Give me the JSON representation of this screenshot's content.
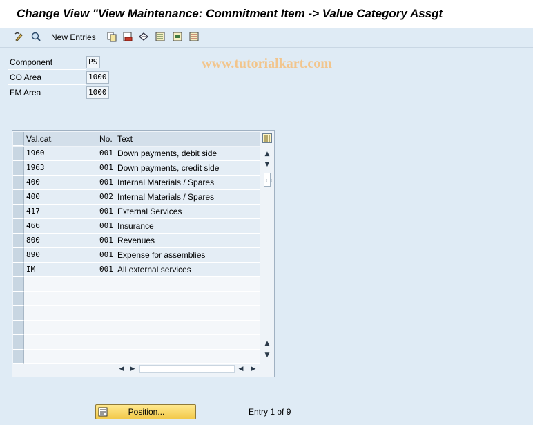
{
  "window": {
    "title": "Change View \"View Maintenance: Commitment Item -> Value Category Assgt"
  },
  "toolbar": {
    "new_entries_label": "New Entries",
    "icons": [
      "display-change-icon",
      "other-view-icon",
      "copy-icon",
      "delete-icon",
      "undo-icon",
      "select-all-icon",
      "select-block-icon",
      "deselect-all-icon"
    ]
  },
  "watermark": "www.tutorialkart.com",
  "fields": {
    "component": {
      "label": "Component",
      "value": "PS"
    },
    "co_area": {
      "label": "CO Area",
      "value": "1000"
    },
    "fm_area": {
      "label": "FM Area",
      "value": "1000"
    }
  },
  "table": {
    "columns": [
      "Val.cat.",
      "No.",
      "Text"
    ],
    "rows": [
      {
        "valcat": "1960",
        "no": "001",
        "text": "Down payments, debit side"
      },
      {
        "valcat": "1963",
        "no": "001",
        "text": "Down payments, credit side"
      },
      {
        "valcat": "400",
        "no": "001",
        "text": "Internal Materials / Spares"
      },
      {
        "valcat": "400",
        "no": "002",
        "text": "Internal Materials / Spares"
      },
      {
        "valcat": "417",
        "no": "001",
        "text": "External Services"
      },
      {
        "valcat": "466",
        "no": "001",
        "text": "Insurance"
      },
      {
        "valcat": "800",
        "no": "001",
        "text": "Revenues"
      },
      {
        "valcat": "890",
        "no": "001",
        "text": "Expense for assemblies"
      },
      {
        "valcat": "IM",
        "no": "001",
        "text": "All external services"
      }
    ],
    "empty_rows": 6
  },
  "footer": {
    "position_button_label": "Position...",
    "entry_text": "Entry 1 of 9"
  },
  "colors": {
    "background": "#dfebf5",
    "button_accent": "#f2c94a"
  }
}
